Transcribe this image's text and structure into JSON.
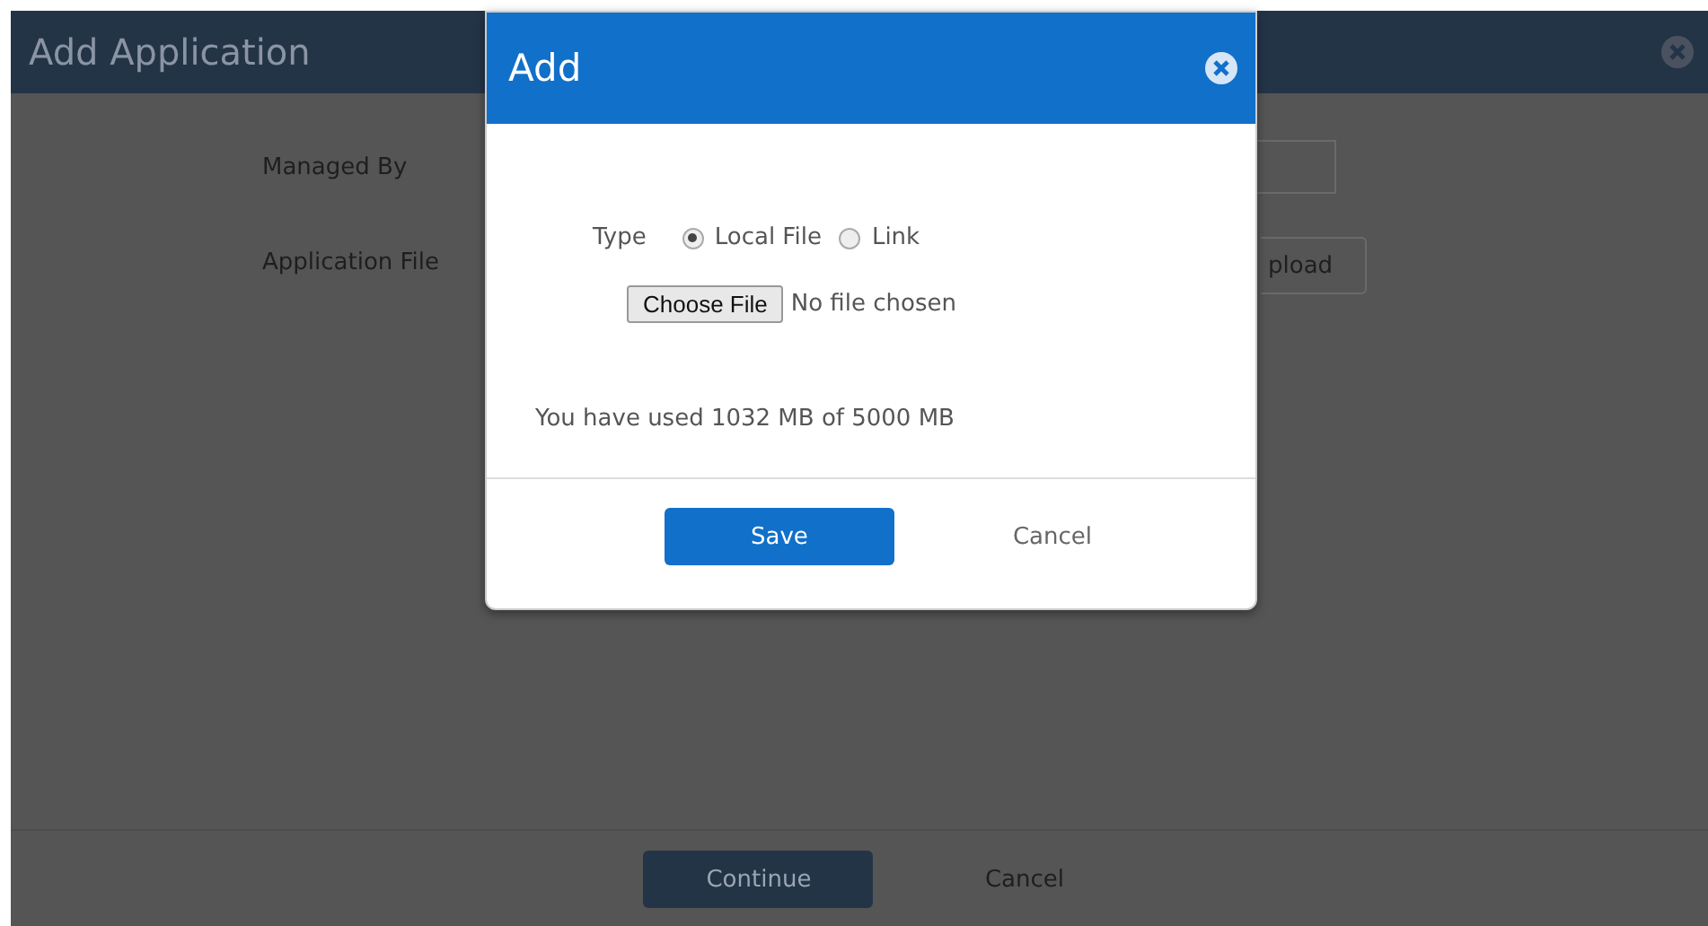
{
  "background_window": {
    "title": "Add Application",
    "fields": [
      {
        "label": "Managed By"
      },
      {
        "label": "Application File"
      }
    ],
    "upload_button": "pload",
    "buttons": [
      "Continue",
      "Cancel"
    ]
  },
  "dialog": {
    "title": "Add",
    "type_label": "Type",
    "type_options": [
      {
        "label": "Local File",
        "selected": true
      },
      {
        "label": "Link",
        "selected": false
      }
    ],
    "file_button": "Choose File",
    "file_status": "No file chosen",
    "usage": "You have used 1032 MB of 5000 MB",
    "save": "Save",
    "cancel": "Cancel"
  }
}
